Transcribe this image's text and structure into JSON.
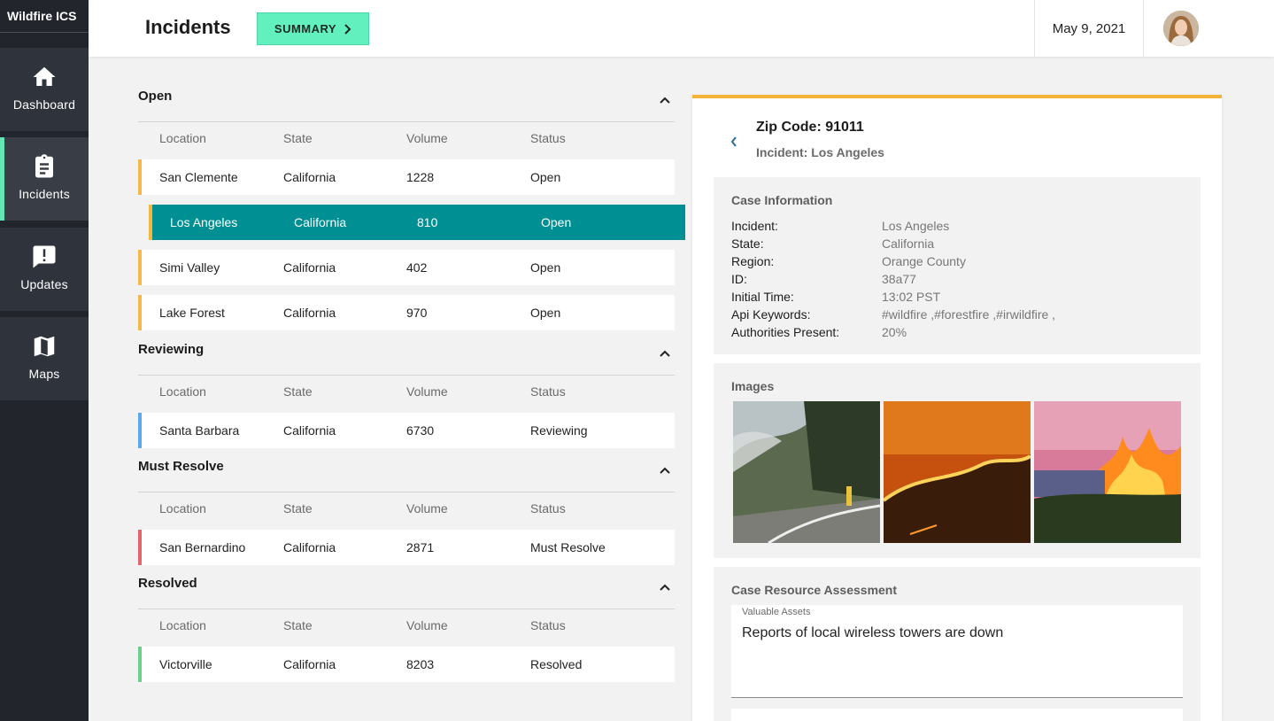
{
  "app": {
    "name": "Wildfire ICS"
  },
  "nav": [
    {
      "label": "Dashboard",
      "icon": "home-icon"
    },
    {
      "label": "Incidents",
      "icon": "clipboard-icon",
      "active": true
    },
    {
      "label": "Updates",
      "icon": "alert-icon"
    },
    {
      "label": "Maps",
      "icon": "map-icon"
    }
  ],
  "header": {
    "title": "Incidents",
    "summary_label": "SUMMARY",
    "date": "May 9, 2021"
  },
  "columns": [
    "Location",
    "State",
    "Volume",
    "Status"
  ],
  "groups": [
    {
      "title": "Open",
      "accent": "#f6b84a",
      "rows": [
        {
          "location": "San Clemente",
          "state": "California",
          "volume": "1228",
          "status": "Open"
        },
        {
          "location": "Los Angeles",
          "state": "California",
          "volume": "810",
          "status": "Open",
          "selected": true
        },
        {
          "location": "Simi Valley",
          "state": "California",
          "volume": "402",
          "status": "Open"
        },
        {
          "location": "Lake Forest",
          "state": "California",
          "volume": "970",
          "status": "Open"
        }
      ]
    },
    {
      "title": "Reviewing",
      "accent": "#5aa9f0",
      "rows": [
        {
          "location": "Santa Barbara",
          "state": "California",
          "volume": "6730",
          "status": "Reviewing"
        }
      ]
    },
    {
      "title": "Must Resolve",
      "accent": "#e2666b",
      "rows": [
        {
          "location": "San Bernardino",
          "state": "California",
          "volume": "2871",
          "status": "Must Resolve"
        }
      ]
    },
    {
      "title": "Resolved",
      "accent": "#6ccf8a",
      "rows": [
        {
          "location": "Victorville",
          "state": "California",
          "volume": "8203",
          "status": "Resolved"
        }
      ]
    }
  ],
  "detail": {
    "zip": "Zip Code: 91011",
    "incident": "Incident: Los Angeles",
    "case_title": "Case Information",
    "case_info": [
      {
        "key": "Incident:",
        "value": "Los Angeles"
      },
      {
        "key": "State:",
        "value": "California"
      },
      {
        "key": "Region:",
        "value": "Orange County"
      },
      {
        "key": "ID:",
        "value": "38a77"
      },
      {
        "key": "Initial Time:",
        "value": "13:02 PST"
      },
      {
        "key": "Api Keywords:",
        "value": "#wildfire ,#forestfire ,#irwildfire ,"
      },
      {
        "key": "Authorities Present:",
        "value": "20%"
      }
    ],
    "images_title": "Images",
    "images": [
      "wildfire-road-photo",
      "wildfire-hillside-photo",
      "wildfire-house-photo"
    ],
    "resource_title": "Case Resource Assessment",
    "assets_label": "Valuable Assets",
    "assets_value": "Reports of local wireless towers are down"
  },
  "colors": {
    "accent_green": "#63f0bf",
    "selected_row": "#008f92",
    "detail_top": "#f6b339",
    "sidebar": "#22252c"
  }
}
